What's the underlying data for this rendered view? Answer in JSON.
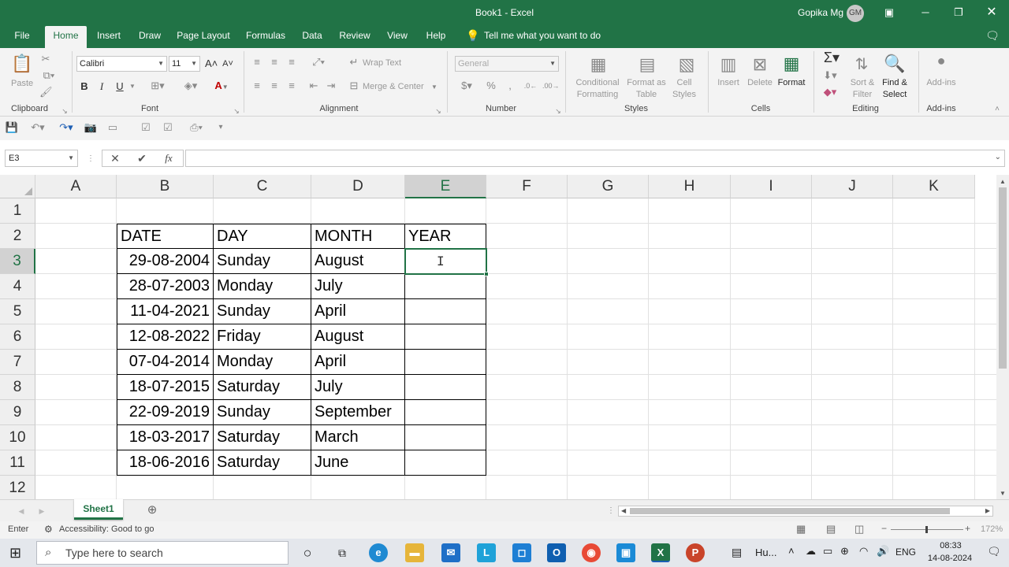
{
  "window": {
    "title": "Book1  -  Excel",
    "user": "Gopika Mg",
    "avatar_initials": "GM"
  },
  "tabs": [
    "File",
    "Home",
    "Insert",
    "Draw",
    "Page Layout",
    "Formulas",
    "Data",
    "Review",
    "View",
    "Help"
  ],
  "tell_me": "Tell me what you want to do",
  "ribbon": {
    "clipboard": {
      "label": "Clipboard",
      "paste": "Paste"
    },
    "font": {
      "label": "Font",
      "name": "Calibri",
      "size": "11",
      "bold": "B",
      "italic": "I",
      "underline": "U"
    },
    "alignment": {
      "label": "Alignment",
      "wrap_text": "Wrap Text",
      "merge_center": "Merge & Center"
    },
    "number": {
      "label": "Number",
      "format": "General"
    },
    "styles": {
      "label": "Styles",
      "conditional": [
        "Conditional",
        "Formatting"
      ],
      "format_as": [
        "Format as",
        "Table"
      ],
      "cell_styles": [
        "Cell",
        "Styles"
      ]
    },
    "cells": {
      "label": "Cells",
      "insert": "Insert",
      "delete": "Delete",
      "format": "Format"
    },
    "editing": {
      "label": "Editing",
      "sort": [
        "Sort &",
        "Filter"
      ],
      "find": [
        "Find &",
        "Select"
      ]
    },
    "addins": {
      "label": "Add-ins",
      "addins": "Add-ins"
    }
  },
  "formula_bar": {
    "name_box": "E3",
    "fx": "fx",
    "content": ""
  },
  "columns": [
    "A",
    "B",
    "C",
    "D",
    "E",
    "F",
    "G",
    "H",
    "I",
    "J",
    "K"
  ],
  "selected_column": "E",
  "rows": [
    "1",
    "2",
    "3",
    "4",
    "5",
    "6",
    "7",
    "8",
    "9",
    "10",
    "11",
    "12"
  ],
  "selected_row": "3",
  "table": {
    "headers": [
      "DATE",
      "DAY",
      "MONTH",
      "YEAR"
    ],
    "data": [
      [
        "29-08-2004",
        "Sunday",
        "August",
        ""
      ],
      [
        "28-07-2003",
        "Monday",
        "July",
        ""
      ],
      [
        "11-04-2021",
        "Sunday",
        "April",
        ""
      ],
      [
        "12-08-2022",
        "Friday",
        "August",
        ""
      ],
      [
        "07-04-2014",
        "Monday",
        "April",
        ""
      ],
      [
        "18-07-2015",
        "Saturday",
        "July",
        ""
      ],
      [
        "22-09-2019",
        "Sunday",
        "September",
        ""
      ],
      [
        "18-03-2017",
        "Saturday",
        "March",
        ""
      ],
      [
        "18-06-2016",
        "Saturday",
        "June",
        ""
      ]
    ]
  },
  "sheet_tabs": [
    "Sheet1"
  ],
  "status": {
    "mode": "Enter",
    "accessibility": "Accessibility: Good to go",
    "zoom": "172%"
  },
  "taskbar": {
    "search_placeholder": "Type here to search",
    "weather": "Hu...",
    "lang": "ENG",
    "time": "08:33",
    "date": "14-08-2024"
  },
  "colors": {
    "excel_green": "#217346",
    "selection_green": "#217346"
  }
}
